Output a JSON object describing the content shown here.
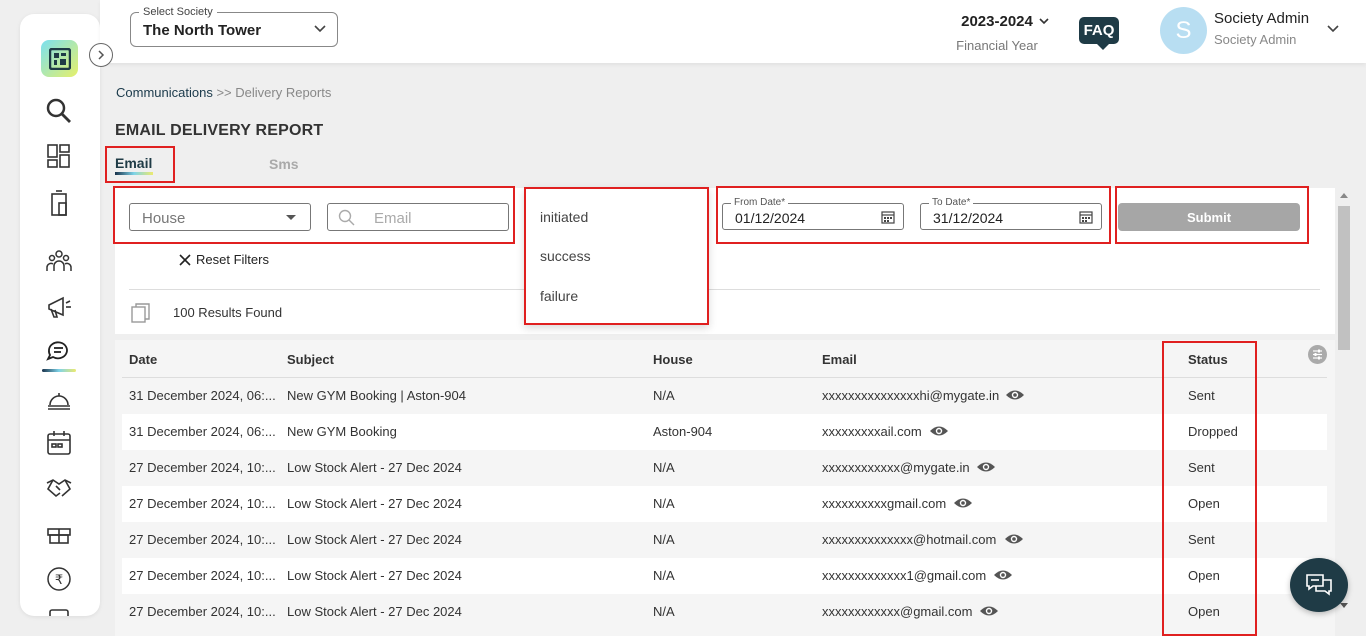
{
  "header": {
    "society_label": "Select Society",
    "society_value": "The North Tower",
    "financial_year": "2023-2024",
    "financial_year_label": "Financial Year",
    "faq_label": "FAQ",
    "avatar_initial": "S",
    "user_name": "Society Admin",
    "user_role": "Society Admin"
  },
  "breadcrumb": {
    "root": "Communications",
    "separator": ">>",
    "current": "Delivery Reports"
  },
  "page_title": "EMAIL DELIVERY REPORT",
  "tabs": {
    "email": "Email",
    "sms": "Sms"
  },
  "filters": {
    "house_placeholder": "House",
    "email_placeholder": "Email",
    "reset_label": "Reset Filters",
    "from_date_label": "From Date*",
    "from_date_value": "01/12/2024",
    "to_date_label": "To Date*",
    "to_date_value": "31/12/2024",
    "submit_label": "Submit",
    "status_options": [
      "initiated",
      "success",
      "failure"
    ]
  },
  "results_text": "100 Results Found",
  "table": {
    "columns": [
      "Date",
      "Subject",
      "House",
      "Email",
      "Status"
    ],
    "rows": [
      {
        "date": "31 December 2024, 06:...",
        "subject": "New GYM Booking | Aston-904",
        "house": "N/A",
        "email": "xxxxxxxxxxxxxxxhi@mygate.in",
        "status": "Sent"
      },
      {
        "date": "31 December 2024, 06:...",
        "subject": "New GYM Booking",
        "house": "Aston-904",
        "email": "xxxxxxxxxail.com",
        "status": "Dropped"
      },
      {
        "date": "27 December 2024, 10:...",
        "subject": "Low Stock Alert - 27 Dec 2024",
        "house": "N/A",
        "email": "xxxxxxxxxxxx@mygate.in",
        "status": "Sent"
      },
      {
        "date": "27 December 2024, 10:...",
        "subject": "Low Stock Alert - 27 Dec 2024",
        "house": "N/A",
        "email": "xxxxxxxxxxgmail.com",
        "status": "Open"
      },
      {
        "date": "27 December 2024, 10:...",
        "subject": "Low Stock Alert - 27 Dec 2024",
        "house": "N/A",
        "email": "xxxxxxxxxxxxxx@hotmail.com",
        "status": "Sent"
      },
      {
        "date": "27 December 2024, 10:...",
        "subject": "Low Stock Alert - 27 Dec 2024",
        "house": "N/A",
        "email": "xxxxxxxxxxxxx1@gmail.com",
        "status": "Open"
      },
      {
        "date": "27 December 2024, 10:...",
        "subject": "Low Stock Alert - 27 Dec 2024",
        "house": "N/A",
        "email": "xxxxxxxxxxxx@gmail.com",
        "status": "Open"
      }
    ]
  },
  "sidebar": {
    "icons": [
      "search-icon",
      "dashboard-icon",
      "building-icon",
      "community-icon",
      "announcement-icon",
      "communications-icon",
      "concierge-icon",
      "calendar-icon",
      "handshake-icon",
      "gift-icon",
      "rupee-icon",
      "document-icon"
    ]
  },
  "colors": {
    "accent_dark": "#1f3b46",
    "highlight_red": "#e02020",
    "submit_disabled": "#a6a6a6"
  }
}
